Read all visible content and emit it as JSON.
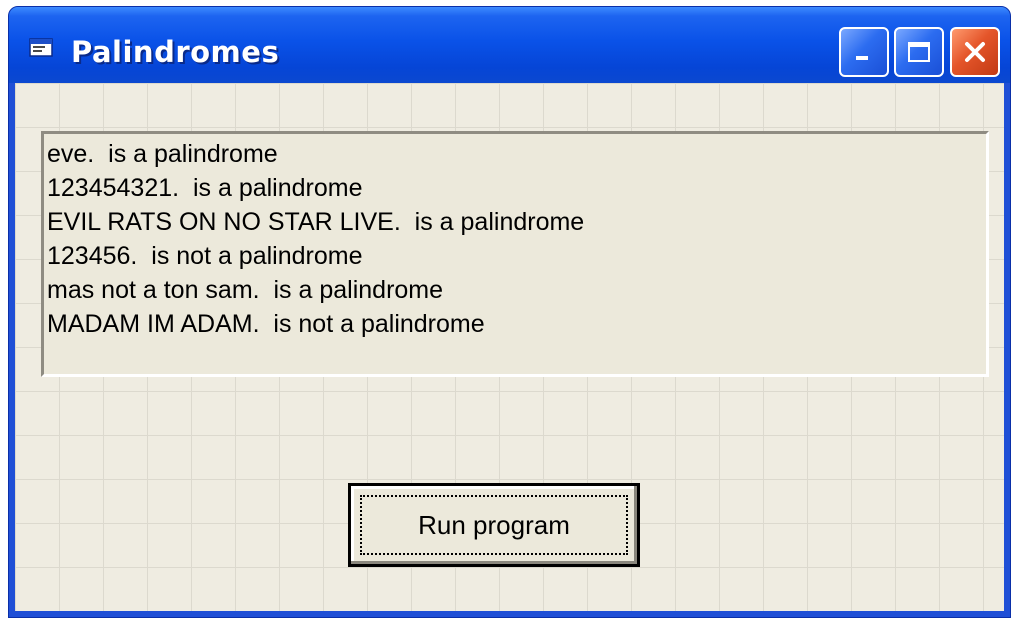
{
  "window": {
    "title": "Palindromes",
    "controls": {
      "minimize": "minimize-icon",
      "maximize": "maximize-icon",
      "close": "close-icon"
    }
  },
  "output": {
    "lines": [
      "eve.  is a palindrome",
      "123454321.  is a palindrome",
      "EVIL RATS ON NO STAR LIVE.  is a palindrome",
      "123456.  is not a palindrome",
      "mas not a ton sam.  is a palindrome",
      "MADAM IM ADAM.  is not a palindrome"
    ]
  },
  "run_button": {
    "label": "Run program"
  },
  "colors": {
    "titlebar": "#0a52e8",
    "client": "#efece1",
    "close_button": "#e4552a"
  }
}
